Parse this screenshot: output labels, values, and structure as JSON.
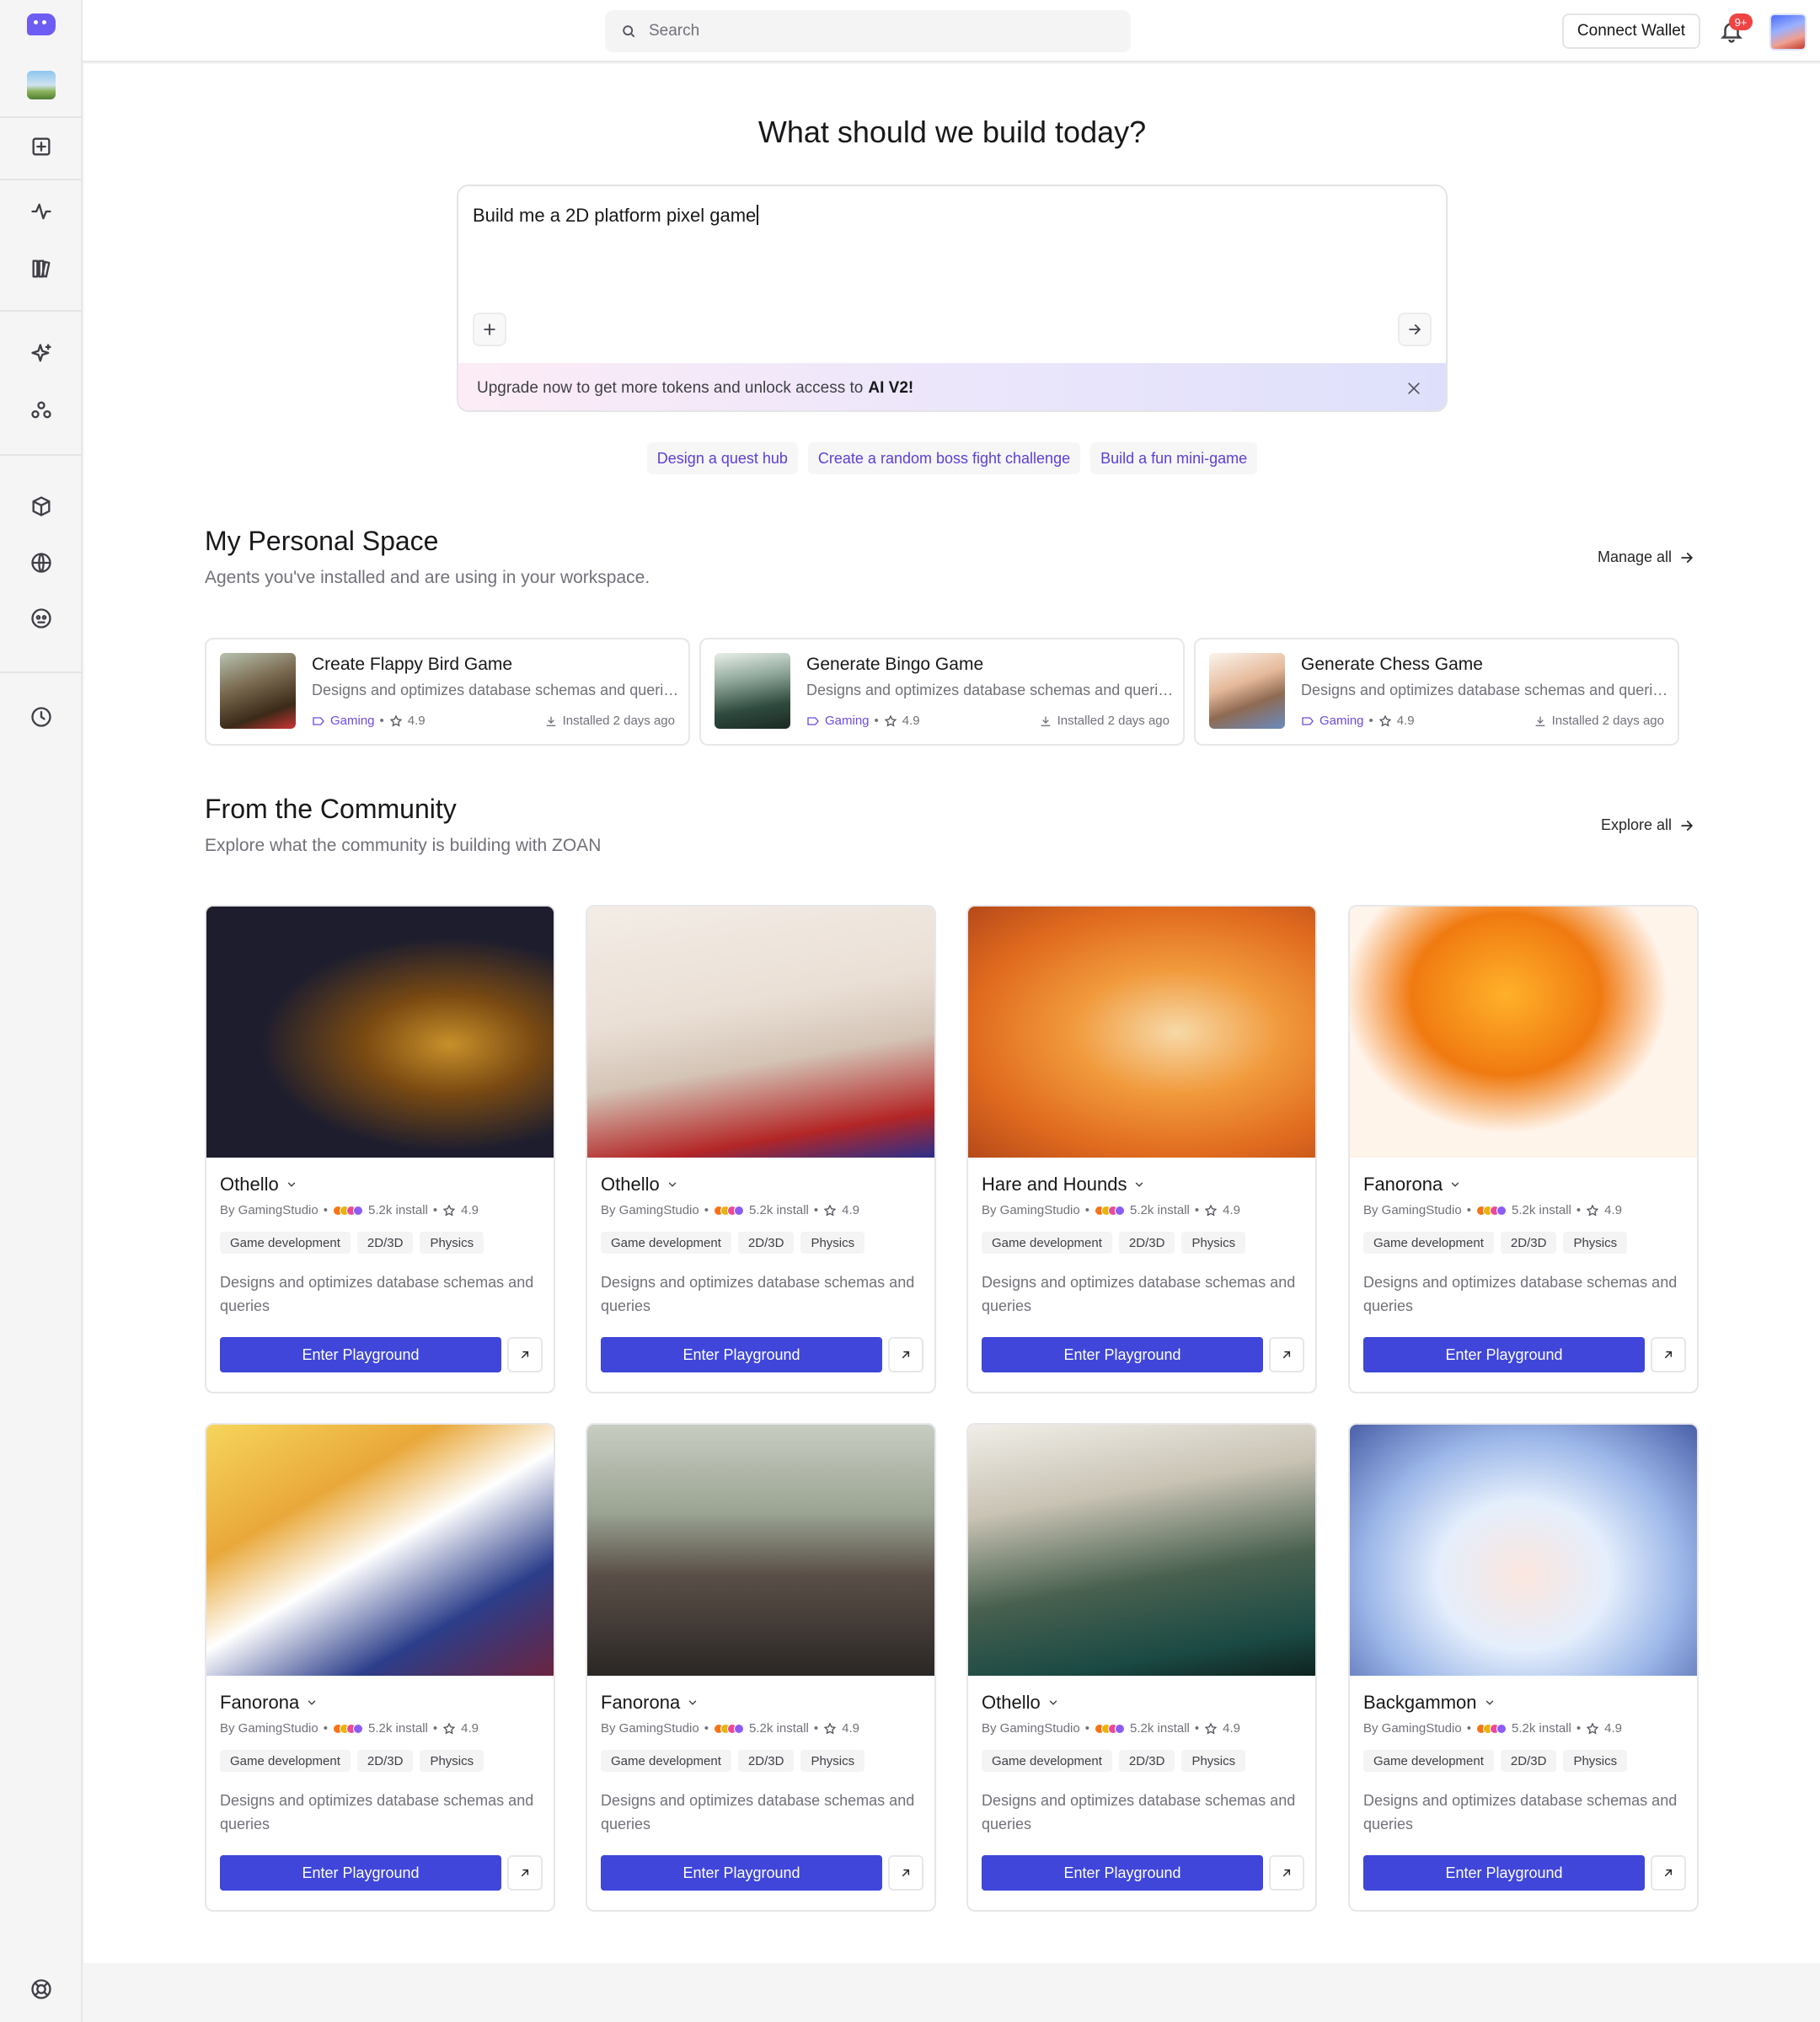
{
  "search": {
    "placeholder": "Search"
  },
  "header": {
    "connect_wallet": "Connect Wallet",
    "notification_badge": "9+"
  },
  "sidebar": {
    "icons": [
      "logo",
      "recent-project-thumbnail",
      "new-project-icon",
      "activity-icon",
      "library-icon",
      "ai-sparkle-icon",
      "community-icon",
      "cube-icon",
      "globe-icon",
      "agent-icon",
      "history-icon",
      "help-icon"
    ]
  },
  "hero": {
    "title": "What should we build today?",
    "prompt": "Build me a 2D platform pixel game",
    "upgrade_text": "Upgrade now to get more tokens and unlock access to",
    "upgrade_bold": "AI V2!",
    "suggestions": [
      "Design a quest hub",
      "Create a random boss fight challenge",
      "Build a fun mini-game"
    ]
  },
  "personal": {
    "title": "My Personal Space",
    "subtitle": "Agents you've installed and are using in your workspace.",
    "link": "Manage all",
    "cards": [
      {
        "title": "Create Flappy Bird Game",
        "desc": "Designs and optimizes database schemas and queries",
        "category": "Gaming",
        "rating": "4.9",
        "installed": "Installed 2 days ago"
      },
      {
        "title": "Generate Bingo Game",
        "desc": "Designs and optimizes database schemas and queries",
        "category": "Gaming",
        "rating": "4.9",
        "installed": "Installed 2 days ago"
      },
      {
        "title": "Generate Chess Game",
        "desc": "Designs and optimizes database schemas and queries",
        "category": "Gaming",
        "rating": "4.9",
        "installed": "Installed 2 days ago"
      }
    ]
  },
  "community": {
    "title": "From the Community",
    "subtitle": "Explore what the community is building with ZOAN",
    "link": "Explore all",
    "enter_label": "Enter Playground",
    "cards": [
      {
        "title": "Othello",
        "author": "By GamingStudio",
        "installs": "5.2k install",
        "rating": "4.9",
        "tags": [
          "Game development",
          "2D/3D",
          "Physics"
        ],
        "desc": "Designs and optimizes database schemas and queries"
      },
      {
        "title": "Othello",
        "author": "By GamingStudio",
        "installs": "5.2k install",
        "rating": "4.9",
        "tags": [
          "Game development",
          "2D/3D",
          "Physics"
        ],
        "desc": "Designs and optimizes database schemas and queries"
      },
      {
        "title": "Hare and Hounds",
        "author": "By GamingStudio",
        "installs": "5.2k install",
        "rating": "4.9",
        "tags": [
          "Game development",
          "2D/3D",
          "Physics"
        ],
        "desc": "Designs and optimizes database schemas and queries"
      },
      {
        "title": "Fanorona",
        "author": "By GamingStudio",
        "installs": "5.2k install",
        "rating": "4.9",
        "tags": [
          "Game development",
          "2D/3D",
          "Physics"
        ],
        "desc": "Designs and optimizes database schemas and queries"
      },
      {
        "title": "Fanorona",
        "author": "By GamingStudio",
        "installs": "5.2k install",
        "rating": "4.9",
        "tags": [
          "Game development",
          "2D/3D",
          "Physics"
        ],
        "desc": "Designs and optimizes database schemas and queries"
      },
      {
        "title": "Fanorona",
        "author": "By GamingStudio",
        "installs": "5.2k install",
        "rating": "4.9",
        "tags": [
          "Game development",
          "2D/3D",
          "Physics"
        ],
        "desc": "Designs and optimizes database schemas and queries"
      },
      {
        "title": "Othello",
        "author": "By GamingStudio",
        "installs": "5.2k install",
        "rating": "4.9",
        "tags": [
          "Game development",
          "2D/3D",
          "Physics"
        ],
        "desc": "Designs and optimizes database schemas and queries"
      },
      {
        "title": "Backgammon",
        "author": "By GamingStudio",
        "installs": "5.2k install",
        "rating": "4.9",
        "tags": [
          "Game development",
          "2D/3D",
          "Physics"
        ],
        "desc": "Designs and optimizes database schemas and queries"
      }
    ]
  },
  "colors": {
    "accent": "#3f46d9",
    "link_purple": "#5b3fd6",
    "badge_red": "#ef4444"
  }
}
